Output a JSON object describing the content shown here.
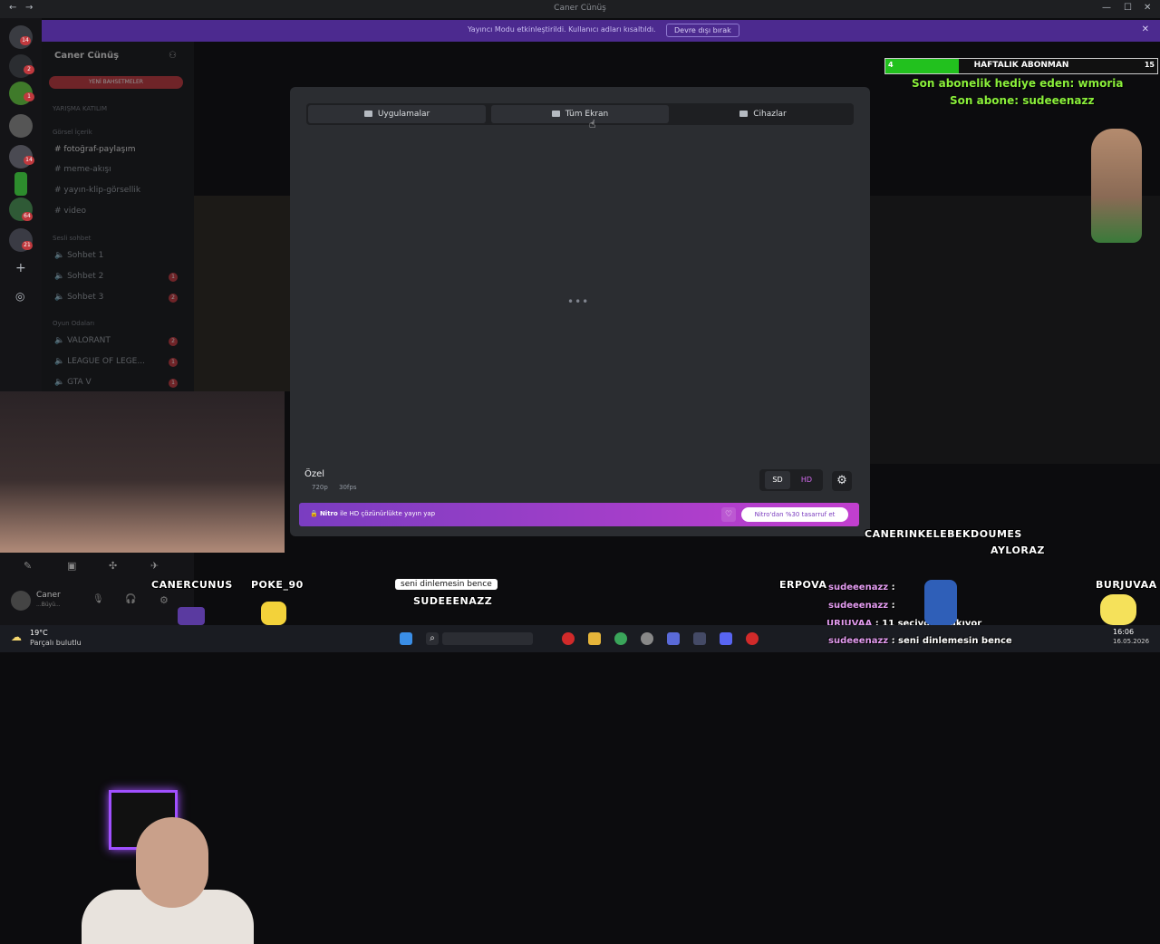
{
  "window": {
    "title": "Caner Cünüş"
  },
  "banner": {
    "message": "Yayıncı Modu etkinleştirildi. Kullanıcı adları kısaltıldı.",
    "button": "Devre dışı bırak"
  },
  "rail": {
    "badges": [
      "14",
      "2",
      "1",
      "14",
      "64",
      "21"
    ]
  },
  "sidebar": {
    "server_name": "Caner Cünüş",
    "new_button": "YENİ BAHSETMELER",
    "categories": [
      "YARIŞMA KATILIM",
      "Görsel İçerik",
      "Sesli sohbet",
      "Oyun Odaları"
    ],
    "text_channels": [
      "fotoğraf-paylaşım",
      "meme-akışı",
      "yayın-klip-görsellik",
      "video"
    ],
    "voice_channels": [
      "Sohbet 1",
      "Sohbet 2",
      "Sohbet 3"
    ],
    "game_channels": [
      "VALORANT",
      "LEAGUE OF LEGE...",
      "GTA V"
    ],
    "channel_badges": [
      "1",
      "2",
      "2",
      "1",
      "1"
    ]
  },
  "user_panel": {
    "name": "Caner",
    "status": "...Büyü..."
  },
  "modal": {
    "tabs": [
      {
        "label": "Uygulamalar",
        "icon": "window-icon",
        "selected": true
      },
      {
        "label": "Tüm Ekran",
        "icon": "monitor-icon",
        "selected": false
      },
      {
        "label": "Cihazlar",
        "icon": "camera-icon",
        "selected": false
      }
    ],
    "loading": "•••",
    "quality_title": "Özel",
    "resolution": "720p",
    "fps": "30fps",
    "sd_label": "SD",
    "hd_label": "HD",
    "nitro_brand": "Nitro",
    "nitro_text": "ile HD çözünürlükte yayın yap",
    "nitro_save": "Nitro'dan %30 tasarruf et"
  },
  "overlay": {
    "sub_bar": {
      "current": "4",
      "label": "HAFTALIK ABONMAN",
      "goal": "15",
      "progress_fraction": 0.27
    },
    "gift_line": "Son abonelik hediye eden: wmoria",
    "last_sub": "Son abone: sudeeenazz",
    "floating_names": [
      "CANERINKELEBEKDOUMES",
      "AYLORAZ",
      "CANERCUNUS",
      "POKE_90",
      "SUDEEENAZZ",
      "ERPOVA",
      "BURJUVAA"
    ],
    "speech_bubble": "seni dinlemesin bence",
    "chat": [
      {
        "user": "sudeeenazz",
        "text": ":"
      },
      {
        "user": "sudeeenazz",
        "text": ":"
      },
      {
        "user": "URJUVAA",
        "text": ": 11 seçiyo... bakıyor"
      },
      {
        "user": "sudeeenazz",
        "text": ": seni dinlemesin bence"
      }
    ]
  },
  "taskbar": {
    "weather_temp": "19°C",
    "weather_desc": "Parçalı bulutlu",
    "time": "16:06",
    "date": "16.05.2026"
  }
}
